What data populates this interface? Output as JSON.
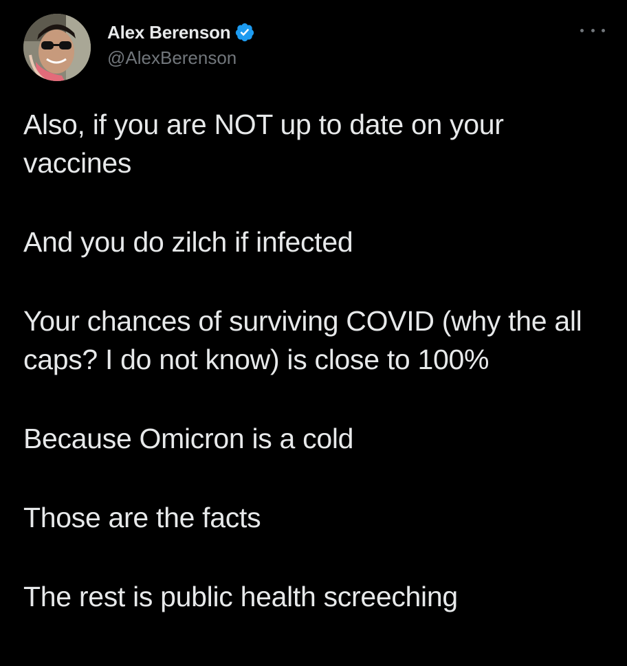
{
  "author": {
    "display_name": "Alex Berenson",
    "handle": "@AlexBerenson",
    "verified": true,
    "avatar_icon": "profile-photo"
  },
  "menu": {
    "icon": "more-horizontal-icon"
  },
  "tweet": {
    "paragraphs": [
      "Also, if you are NOT up to date on your vaccines",
      "And you do zilch if infected",
      "Your chances of surviving COVID (why the all caps? I do not know) is close to 100%",
      "Because Omicron is a cold",
      "Those are the facts",
      "The rest is public health screeching"
    ]
  },
  "colors": {
    "background": "#000000",
    "text": "#e7e9ea",
    "secondary": "#71767b",
    "verified_blue": "#1d9bf0"
  }
}
